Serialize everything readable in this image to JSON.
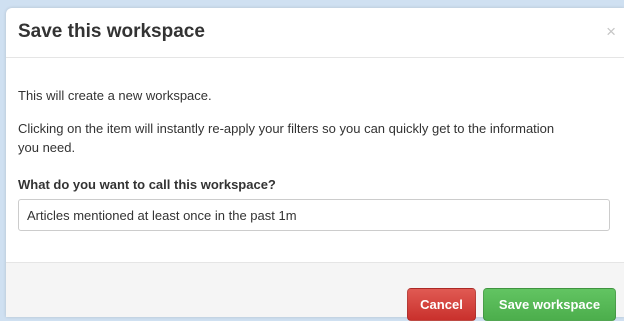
{
  "modal": {
    "title": "Save this workspace",
    "close_glyph": "×",
    "body": {
      "intro": "This will create a new workspace.",
      "description": "Clicking on the item will instantly re-apply your filters so you can quickly get to the information you need.",
      "question": "What do you want to call this workspace?",
      "name_value": "Articles mentioned at least once in the past 1m"
    },
    "footer": {
      "cancel_label": "Cancel",
      "save_label": "Save workspace"
    }
  },
  "colors": {
    "cancel": "#d9534f",
    "save": "#5cb85c",
    "backdrop": "#cfe0f1"
  },
  "icons": {
    "close": "close-icon"
  }
}
